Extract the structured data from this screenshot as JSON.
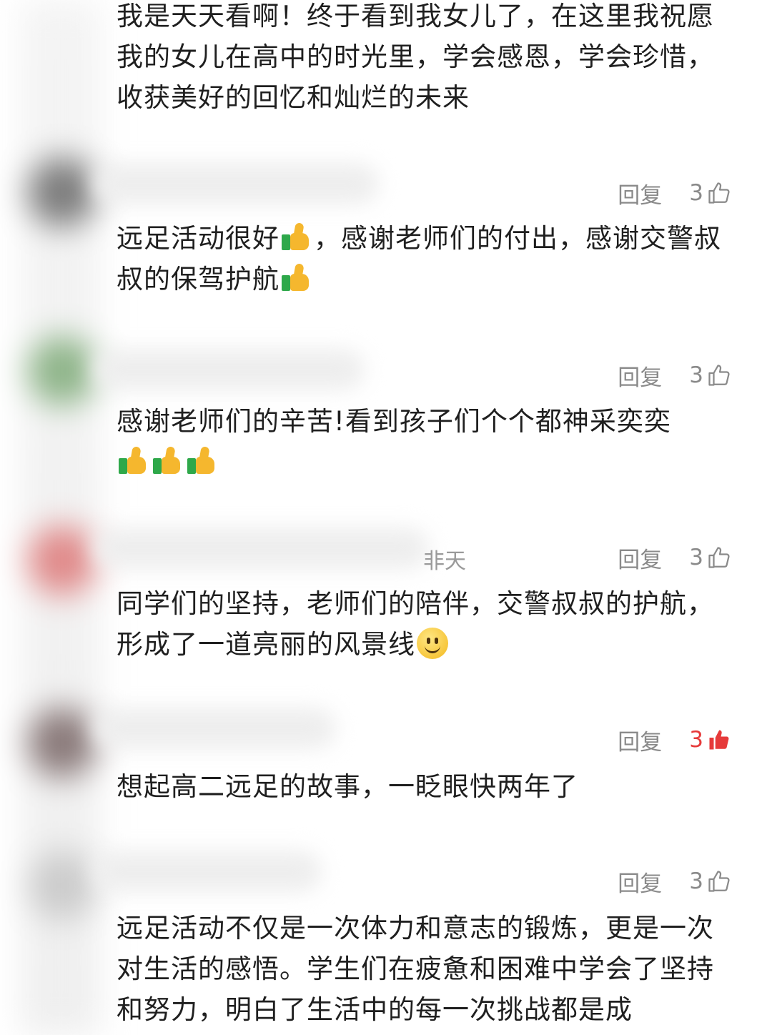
{
  "comments": [
    {
      "name_tail": "",
      "text": "我是天天看啊！终于看到我女儿了，在这里我祝愿我的女儿在高中的时光里，学会感恩，学会珍惜，收获美好的回忆和灿烂的未来",
      "reply_label": "回复",
      "likes": "3",
      "liked": false
    },
    {
      "name_tail": "",
      "text_parts": [
        "远足活动很好",
        "，感谢老师们的付出，感谢交警叔叔的保驾护航"
      ],
      "reply_label": "回复",
      "likes": "3",
      "liked": false
    },
    {
      "name_tail": "",
      "text": "感谢老师们的辛苦!看到孩子们个个都神采奕奕",
      "reply_label": "回复",
      "likes": "3",
      "liked": false
    },
    {
      "name_tail": "非天",
      "text": "同学们的坚持，老师们的陪伴，交警叔叔的护航，形成了一道亮丽的风景线",
      "reply_label": "回复",
      "likes": "3",
      "liked": true
    },
    {
      "name_tail": "",
      "text": "想起高二远足的故事，一眨眼快两年了",
      "reply_label": "回复",
      "likes": "3",
      "liked": false
    },
    {
      "name_tail": "",
      "text": "远足活动不仅是一次体力和意志的锻炼，更是一次对生活的感悟。学生们在疲惫和困难中学会了坚持和努力，明白了生活中的每一次挑战都是成"
    }
  ],
  "icons": {
    "like": "thumbs-up-outline-icon",
    "liked": "thumbs-up-filled-icon",
    "emoji_thumb": "thumbs-up-emoji-icon",
    "emoji_smile": "smiling-face-emoji-icon"
  },
  "colors": {
    "text": "#1f1f1f",
    "meta": "#8a8a8a",
    "liked": "#e63a3a"
  }
}
